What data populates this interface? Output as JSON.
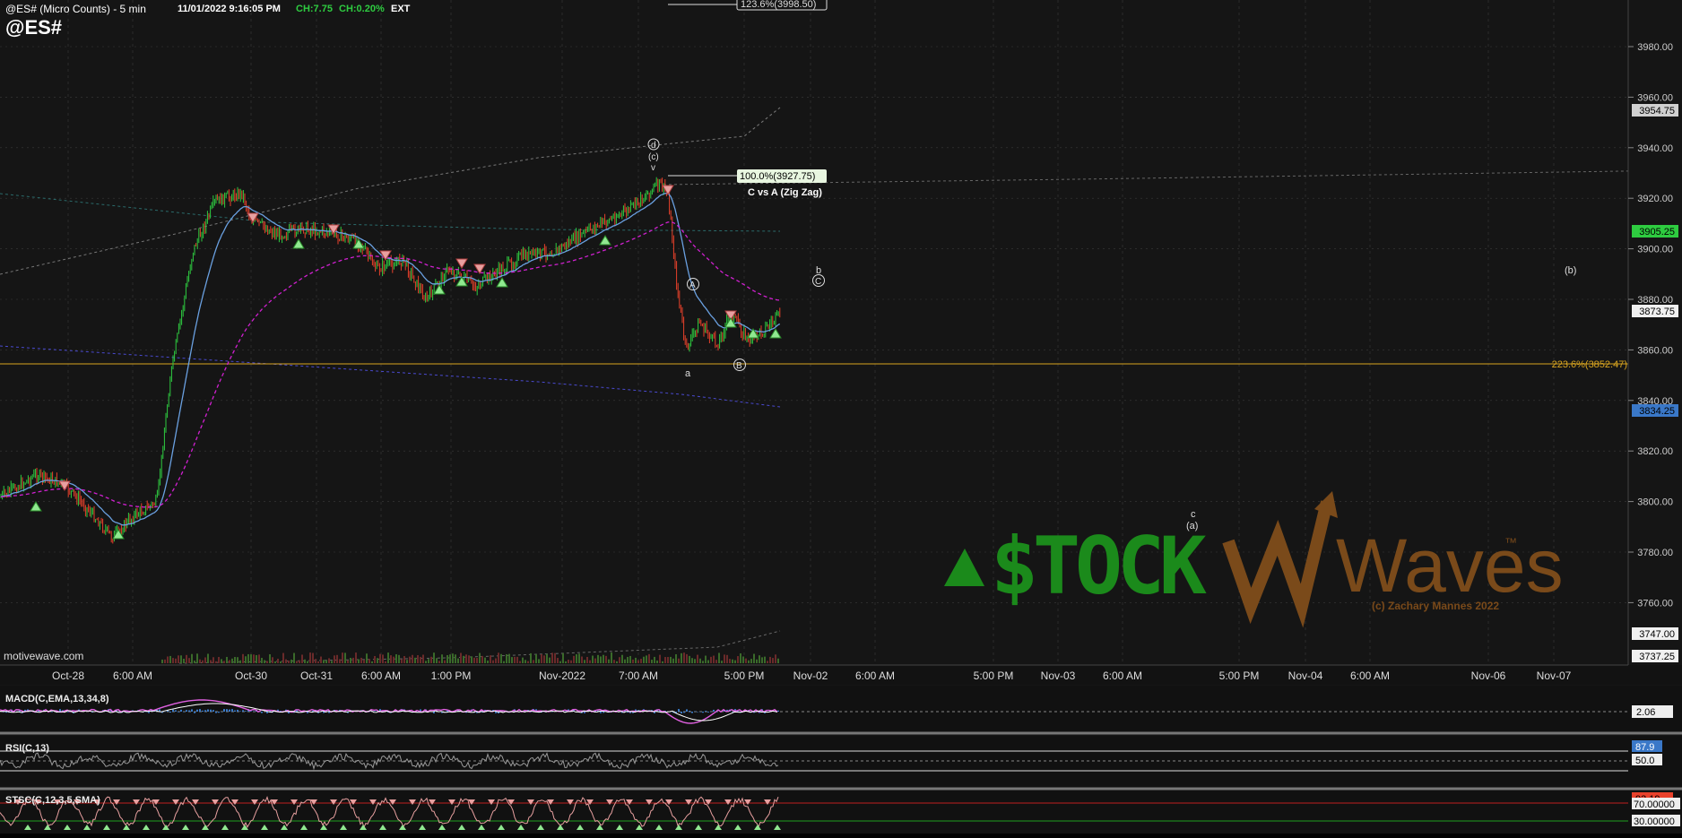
{
  "header": {
    "symbol_desc": "@ES# (Micro Counts) - 5 min",
    "datetime": "11/01/2022 9:16:05 PM",
    "change": "CH:7.75",
    "change_pct": "CH:0.20%",
    "session": "EXT",
    "symbol": "@ES#"
  },
  "colors": {
    "background": "#151515",
    "grid": "#3a3a3a",
    "up_candle": "#2ecc40",
    "down_candle": "#e8412b",
    "fib_line": "#d9a520",
    "ema_fast": "#6aa0e0",
    "ema_slow": "#d020d0",
    "macd": "#e060e0",
    "logo_green": "#1b8a1b",
    "logo_brown": "#7a4a1a",
    "overbought": "#c02020",
    "oversold": "#20a020"
  },
  "price_axis": {
    "ticks": [
      "3980.00",
      "3960.00",
      "3940.00",
      "3920.00",
      "3900.00",
      "3880.00",
      "3860.00",
      "3840.00",
      "3820.00",
      "3800.00",
      "3780.00",
      "3760.00"
    ],
    "tags": [
      {
        "label": "3954.75",
        "color": "#d0d0d0",
        "text": "#000"
      },
      {
        "label": "3905.25",
        "color": "#2ecc40",
        "text": "#000"
      },
      {
        "label": "3873.75",
        "color": "#f0f0f0",
        "text": "#000"
      },
      {
        "label": "3834.25",
        "color": "#3a78c8",
        "text": "#000"
      },
      {
        "label": "3747.00",
        "color": "#f0f0f0",
        "text": "#000"
      },
      {
        "label": "3737.25",
        "color": "#f0f0f0",
        "text": "#000"
      }
    ]
  },
  "time_axis": {
    "labels": [
      "Oct-28",
      "6:00 AM",
      "Oct-30",
      "Oct-31",
      "6:00 AM",
      "1:00 PM",
      "Nov-2022",
      "7:00 AM",
      "5:00 PM",
      "Nov-02",
      "6:00 AM",
      "5:00 PM",
      "Nov-03",
      "6:00 AM",
      "5:00 PM",
      "Nov-04",
      "6:00 AM",
      "Nov-06",
      "Nov-07"
    ]
  },
  "annotations": {
    "fib_123": "123.6%(3998.50)",
    "fib_100": "100.0%(3927.75)",
    "zigzag": "C vs A (Zig Zag)",
    "fib_2236": "223.6%(3852.47)",
    "wave_d": "d",
    "wave_c_paren": "(c)",
    "wave_v": "v",
    "wave_A": "A",
    "wave_a": "a",
    "wave_B": "B",
    "wave_b": "b",
    "wave_C": "C",
    "wave_b_paren": "(b)",
    "wave_c": "c",
    "wave_a_paren": "(a)"
  },
  "watermark": {
    "stock": "$TOCK",
    "waves": "Waves",
    "tm": "™",
    "copyright": "(c) Zachary Mannes 2022",
    "source": "motivewave.com"
  },
  "macd": {
    "label": "MACD(C,EMA,13,34,8)",
    "value": "2.06"
  },
  "rsi": {
    "label": "RSI(C,13)",
    "value": "87.9",
    "mid": "50.0"
  },
  "stoch": {
    "label": "STSC(C,12,3,5,SMA)",
    "upper": "70.00000",
    "lower": "30.00000",
    "value": "93.19"
  }
}
